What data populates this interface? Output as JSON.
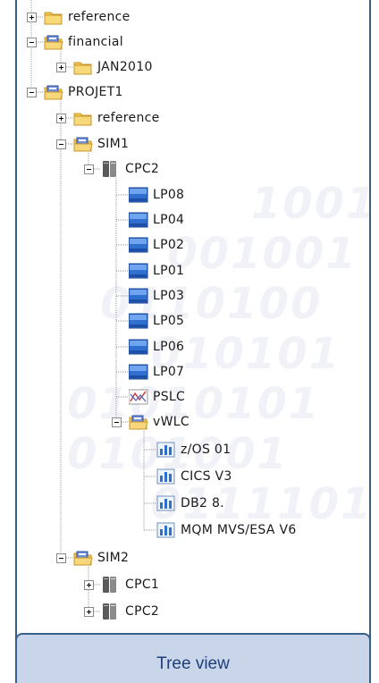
{
  "tree": {
    "nodes": [
      {
        "label": "reference",
        "icon": "folder-icon",
        "expander": "plus"
      },
      {
        "label": "financial",
        "icon": "open-folder-icon",
        "expander": "minus"
      },
      {
        "label": "JAN2010",
        "icon": "folder-icon",
        "expander": "plus"
      },
      {
        "label": "PROJET1",
        "icon": "open-folder-icon",
        "expander": "minus"
      },
      {
        "label": "reference",
        "icon": "folder-icon",
        "expander": "plus"
      },
      {
        "label": "SIM1",
        "icon": "open-folder-icon",
        "expander": "minus"
      },
      {
        "label": "CPC2",
        "icon": "server-icon",
        "expander": "minus"
      },
      {
        "label": "LP08",
        "icon": "partition-icon"
      },
      {
        "label": "LP04",
        "icon": "partition-icon"
      },
      {
        "label": "LP02",
        "icon": "partition-icon"
      },
      {
        "label": "LP01",
        "icon": "partition-icon"
      },
      {
        "label": "LP03",
        "icon": "partition-icon"
      },
      {
        "label": "LP05",
        "icon": "partition-icon"
      },
      {
        "label": "LP06",
        "icon": "partition-icon"
      },
      {
        "label": "LP07",
        "icon": "partition-icon"
      },
      {
        "label": "PSLC",
        "icon": "pslc-chart-icon"
      },
      {
        "label": "vWLC",
        "icon": "open-folder-icon",
        "expander": "minus"
      },
      {
        "label": "z/OS 01",
        "icon": "bar-chart-icon"
      },
      {
        "label": "CICS V3",
        "icon": "bar-chart-icon"
      },
      {
        "label": "DB2 8.",
        "icon": "bar-chart-icon"
      },
      {
        "label": "MQM MVS/ESA V6",
        "icon": "bar-chart-icon"
      },
      {
        "label": "SIM2",
        "icon": "open-folder-icon",
        "expander": "minus"
      },
      {
        "label": "CPC1",
        "icon": "server-icon",
        "expander": "plus"
      },
      {
        "label": "CPC2",
        "icon": "server-icon",
        "expander": "plus"
      }
    ]
  },
  "caption": "Tree view",
  "colors": {
    "frame": "#3a5f8a",
    "caption_bg": "#c9d5e8",
    "caption_text": "#1f3f7a",
    "folder": "#f2c94c"
  }
}
